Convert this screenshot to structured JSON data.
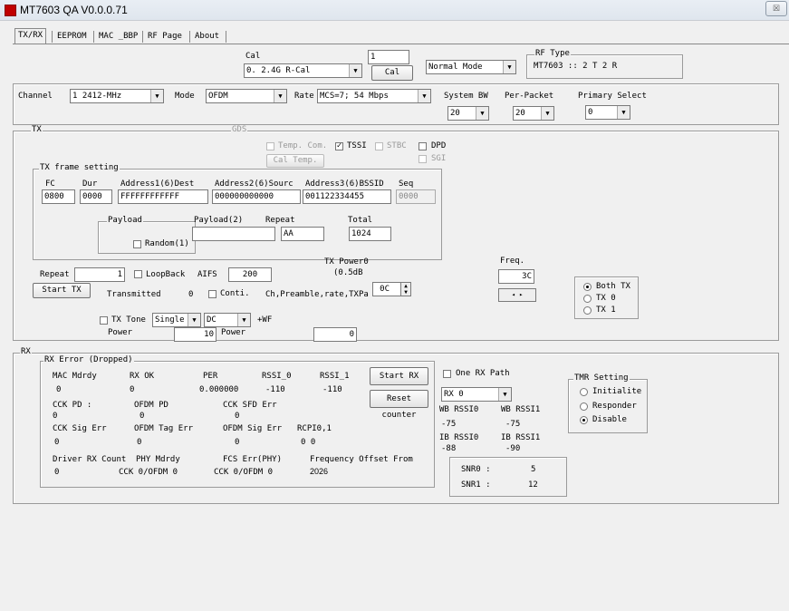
{
  "window": {
    "title": "MT7603 QA V0.0.0.71",
    "close": "☒"
  },
  "tabs": [
    "TX/RX",
    "EEPROM",
    "MAC _BBP",
    "RF Page",
    "About"
  ],
  "cal": {
    "label": "Cal",
    "select": "0. 2.4G R-Cal",
    "number": "1",
    "button": "Cal",
    "mode": "Normal Mode"
  },
  "rf_type": {
    "label": "RF Type",
    "value": "MT7603 :: 2 T 2 R"
  },
  "channel": {
    "channel_label": "Channel",
    "channel_value": "1  2412-MHz",
    "mode_label": "Mode",
    "mode_value": "OFDM",
    "rate_label": "Rate",
    "rate_value": "MCS=7; 54 Mbps",
    "system_bw_label": "System BW",
    "system_bw_value": "20",
    "per_packet_label": "Per-Packet",
    "per_packet_value": "20",
    "primary_label": "Primary Select",
    "primary_value": "0"
  },
  "tx": {
    "label": "TX",
    "gds": "GDS",
    "temp_com": "Temp. Com.",
    "tssi": "TSSI",
    "stbc": "STBC",
    "dpd": "DPD",
    "sgi": "SGI",
    "cal_temp": "Cal Temp.",
    "frame_label": "TX frame setting",
    "fc_label": "FC",
    "fc": "0800",
    "dur_label": "Dur",
    "dur": "0000",
    "addr1_label": "Address1(6)Dest",
    "addr1": "FFFFFFFFFFFF",
    "addr2_label": "Address2(6)Sourc",
    "addr2": "000000000000",
    "addr3_label": "Address3(6)BSSID",
    "addr3": "001122334455",
    "seq_label": "Seq",
    "seq": "0000",
    "payload_label": "Payload",
    "random_label": "Random(1)",
    "payload2_label": "Payload(2)",
    "payload2": "",
    "repeat_label": "Repeat",
    "repeat_val": "AA",
    "total_label": "Total",
    "total": "1024",
    "repeat_row_label": "Repeat",
    "repeat_count": "1",
    "loopback": "LoopBack",
    "aifs_label": "AIFS",
    "aifs": "200",
    "power0_label": "TX Power0",
    "power0_step": "(0.5dB",
    "power0_value": "0C",
    "start_tx": "Start TX",
    "transmitted_label": "Transmitted",
    "transmitted": "0",
    "conti": "Conti.",
    "ch_info": "Ch,Preamble,rate,TXPa",
    "freq_label": "Freq.",
    "freq": "3C",
    "tx_tone": "TX Tone",
    "tone_type": "Single",
    "tone_dc": "DC",
    "wf": "+WF",
    "power_label1": "Power",
    "power_value1": "10",
    "power_label2": "Power",
    "power_value2": "0",
    "both_tx": "Both TX",
    "tx0": "TX 0",
    "tx1": "TX 1"
  },
  "rx": {
    "label": "RX",
    "error_label": "RX Error (Dropped)",
    "mac_mdrdy_label": "MAC Mdrdy",
    "mac_mdrdy": "0",
    "rx_ok_label": "RX OK",
    "rx_ok": "0",
    "per_label": "PER",
    "per": "0.000000",
    "rssi0_label": "RSSI_0",
    "rssi0": "-110",
    "rssi1_label": "RSSI_1",
    "rssi1": "-110",
    "start_rx": "Start RX",
    "reset": "Reset counter",
    "cck_pd_label": "CCK PD :",
    "cck_pd": "0",
    "ofdm_pd_label": "OFDM PD",
    "ofdm_pd": "0",
    "cck_sfd_label": "CCK SFD Err",
    "cck_sfd": "0",
    "cck_sig_label": "CCK Sig Err",
    "cck_sig": "0",
    "ofdm_tag_label": "OFDM Tag Err",
    "ofdm_tag": "0",
    "ofdm_sig_label": "OFDM Sig Err",
    "ofdm_sig": "0",
    "rcpi_label": "RCPI0,1",
    "rcpi": "0  0",
    "driver_label": "Driver RX Count",
    "driver": "0",
    "phy_label": "PHY Mdrdy",
    "phy": "CCK 0/OFDM 0",
    "fcs_label": "FCS Err(PHY)",
    "fcs": "CCK 0/OFDM 0",
    "freq_off_label": "Frequency Offset From",
    "freq_off": "2026",
    "one_rx_path": "One RX Path",
    "rx_select": "RX 0",
    "wb_rssi0_label": "WB RSSI0",
    "wb_rssi0": "-75",
    "wb_rssi1_label": "WB RSSI1",
    "wb_rssi1": "-75",
    "ib_rssi0_label": "IB RSSI0",
    "ib_rssi0": "-88",
    "ib_rssi1_label": "IB RSSI1",
    "ib_rssi1": "-90",
    "snr0_label": "SNR0 :",
    "snr0": "5",
    "snr1_label": "SNR1 :",
    "snr1": "12",
    "tmr_label": "TMR Setting",
    "tmr_init": "Initialite",
    "tmr_resp": "Responder",
    "tmr_disable": "Disable"
  }
}
